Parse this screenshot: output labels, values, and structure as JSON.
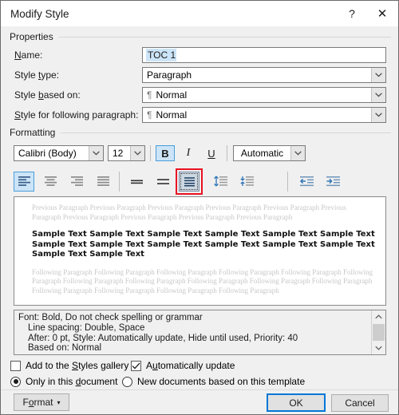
{
  "window": {
    "title": "Modify Style",
    "help_label": "?",
    "close_label": "✕"
  },
  "properties": {
    "group_label": "Properties",
    "name_label": "Name:",
    "name_value": "TOC 1",
    "style_type_label": "Style type:",
    "style_type_value": "Paragraph",
    "style_based_on_label": "Style based on:",
    "style_based_on_value": "Normal",
    "style_following_label": "Style for following paragraph:",
    "style_following_value": "Normal",
    "pilcrow": "¶"
  },
  "formatting": {
    "group_label": "Formatting",
    "font_family_value": "Calibri (Body)",
    "font_size_value": "12",
    "bold_label": "B",
    "italic_label": "I",
    "underline_label": "U",
    "font_color_value": "Automatic",
    "icons": {
      "align_left": "align-left-icon",
      "align_center": "align-center-icon",
      "align_right": "align-right-icon",
      "align_justify": "align-justify-icon",
      "line_spacing_single": "line-spacing-single-icon",
      "line_spacing_15": "line-spacing-1-5-icon",
      "line_spacing_double": "line-spacing-double-icon",
      "space_before": "space-before-icon",
      "space_after": "space-after-icon",
      "decrease_indent": "decrease-indent-icon",
      "increase_indent": "increase-indent-icon"
    },
    "active_alignment": "align-left",
    "active_line_spacing": "line-spacing-double",
    "highlight_color": "#e81123",
    "accent_color": "#0078d7",
    "active_button_fill": "#cce4f7"
  },
  "preview": {
    "previous_paragraph_text": "Previous Paragraph Previous Paragraph Previous Paragraph Previous Paragraph Previous Paragraph Previous Paragraph Previous Paragraph Previous Paragraph Previous Paragraph Previous Paragraph",
    "sample_text": "Sample Text Sample Text Sample Text Sample Text Sample Text Sample Text Sample Text Sample Text Sample Text Sample Text Sample Text Sample Text Sample Text Sample Text",
    "following_paragraph_text": "Following Paragraph Following Paragraph Following Paragraph Following Paragraph Following Paragraph Following Paragraph Following Paragraph Following Paragraph Following Paragraph Following Paragraph Following Paragraph Following Paragraph Following Paragraph Following Paragraph Following Paragraph"
  },
  "description": {
    "line1": "Font: Bold, Do not check spelling or grammar",
    "line2": "Line spacing:  Double, Space",
    "line3": "After:  0 pt, Style: Automatically update, Hide until used, Priority: 40",
    "line4": "Based on: Normal"
  },
  "options": {
    "add_to_gallery_label": "Add to the Styles gallery",
    "add_to_gallery_checked": false,
    "auto_update_label": "Automatically update",
    "auto_update_checked": true,
    "check_glyph": "✓",
    "only_this_document_label": "Only in this document",
    "only_this_document_selected": true,
    "new_documents_label": "New documents based on this template",
    "new_documents_selected": false
  },
  "footer": {
    "format_label": "Format",
    "format_caret": "▾",
    "ok_label": "OK",
    "cancel_label": "Cancel"
  }
}
